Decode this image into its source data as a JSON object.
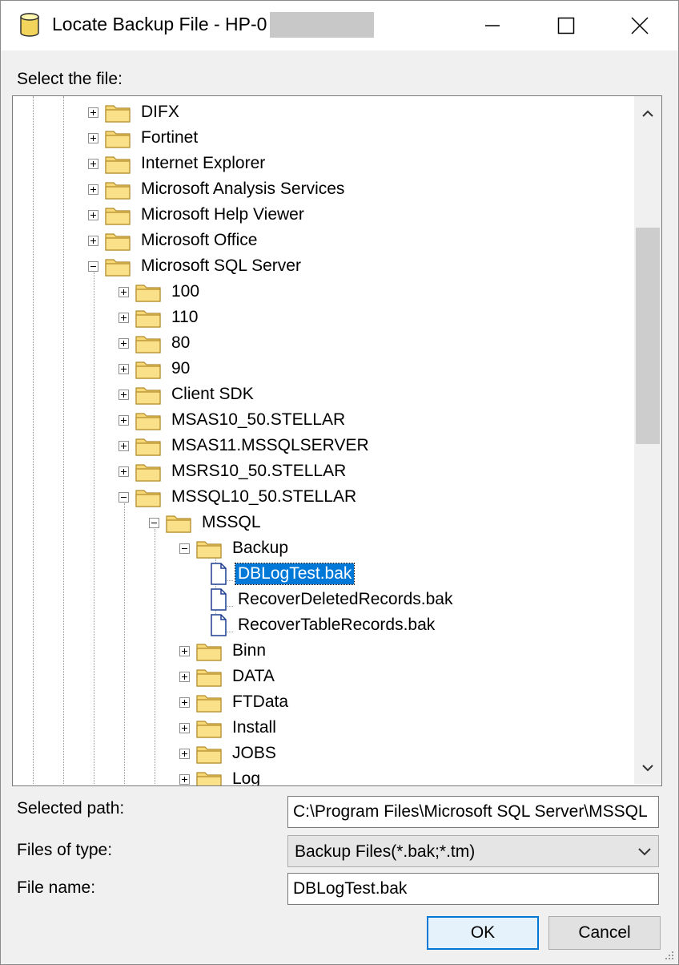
{
  "title": {
    "text": "Locate Backup File - HP-0",
    "minimize_icon": "minimize-icon",
    "maximize_icon": "maximize-icon",
    "close_icon": "close-icon"
  },
  "labels": {
    "select_file": "Select the file:",
    "selected_path": "Selected path:",
    "files_of_type": "Files of type:",
    "file_name": "File name:"
  },
  "tree": [
    {
      "label": "DIFX",
      "level": 0,
      "type": "folder",
      "state": "collapsed"
    },
    {
      "label": "Fortinet",
      "level": 0,
      "type": "folder",
      "state": "collapsed"
    },
    {
      "label": "Internet Explorer",
      "level": 0,
      "type": "folder",
      "state": "collapsed"
    },
    {
      "label": "Microsoft Analysis Services",
      "level": 0,
      "type": "folder",
      "state": "collapsed"
    },
    {
      "label": "Microsoft Help Viewer",
      "level": 0,
      "type": "folder",
      "state": "collapsed"
    },
    {
      "label": "Microsoft Office",
      "level": 0,
      "type": "folder",
      "state": "collapsed"
    },
    {
      "label": "Microsoft SQL Server",
      "level": 0,
      "type": "folder",
      "state": "expanded"
    },
    {
      "label": "100",
      "level": 1,
      "type": "folder",
      "state": "collapsed"
    },
    {
      "label": "110",
      "level": 1,
      "type": "folder",
      "state": "collapsed"
    },
    {
      "label": "80",
      "level": 1,
      "type": "folder",
      "state": "collapsed"
    },
    {
      "label": "90",
      "level": 1,
      "type": "folder",
      "state": "collapsed"
    },
    {
      "label": "Client SDK",
      "level": 1,
      "type": "folder",
      "state": "collapsed"
    },
    {
      "label": "MSAS10_50.STELLAR",
      "level": 1,
      "type": "folder",
      "state": "collapsed"
    },
    {
      "label": "MSAS11.MSSQLSERVER",
      "level": 1,
      "type": "folder",
      "state": "collapsed"
    },
    {
      "label": "MSRS10_50.STELLAR",
      "level": 1,
      "type": "folder",
      "state": "collapsed"
    },
    {
      "label": "MSSQL10_50.STELLAR",
      "level": 1,
      "type": "folder",
      "state": "expanded"
    },
    {
      "label": "MSSQL",
      "level": 2,
      "type": "folder",
      "state": "expanded"
    },
    {
      "label": "Backup",
      "level": 3,
      "type": "folder",
      "state": "expanded"
    },
    {
      "label": "DBLogTest.bak",
      "level": 4,
      "type": "file",
      "selected": true
    },
    {
      "label": "RecoverDeletedRecords.bak",
      "level": 4,
      "type": "file"
    },
    {
      "label": "RecoverTableRecords.bak",
      "level": 4,
      "type": "file"
    },
    {
      "label": "Binn",
      "level": 3,
      "type": "folder",
      "state": "collapsed"
    },
    {
      "label": "DATA",
      "level": 3,
      "type": "folder",
      "state": "collapsed"
    },
    {
      "label": "FTData",
      "level": 3,
      "type": "folder",
      "state": "collapsed"
    },
    {
      "label": "Install",
      "level": 3,
      "type": "folder",
      "state": "collapsed"
    },
    {
      "label": "JOBS",
      "level": 3,
      "type": "folder",
      "state": "collapsed"
    },
    {
      "label": "Log",
      "level": 3,
      "type": "folder",
      "state": "collapsed"
    }
  ],
  "fields": {
    "selected_path": "C:\\Program Files\\Microsoft SQL Server\\MSSQL",
    "files_of_type": "Backup Files(*.bak;*.tm)",
    "file_name": "DBLogTest.bak"
  },
  "buttons": {
    "ok": "OK",
    "cancel": "Cancel"
  },
  "colors": {
    "selection": "#0078d7",
    "folder": "#f8d775"
  }
}
